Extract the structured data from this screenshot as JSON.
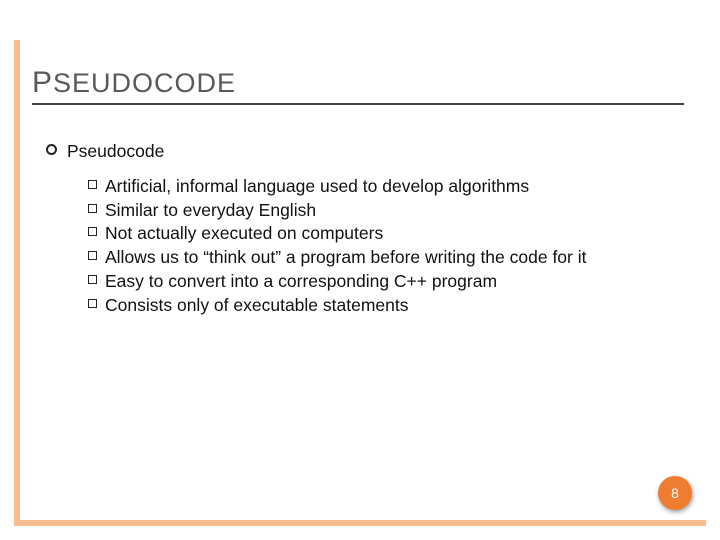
{
  "title": {
    "first": "P",
    "rest": "SEUDOCODE"
  },
  "heading": "Pseudocode",
  "bullets": [
    "Artificial, informal language used to develop algorithms",
    "Similar to everyday English",
    "Not actually executed on computers",
    "Allows us to “think out” a program before writing the code for it",
    "Easy to convert into a corresponding C++ program",
    "Consists only of executable statements"
  ],
  "page_number": "8"
}
